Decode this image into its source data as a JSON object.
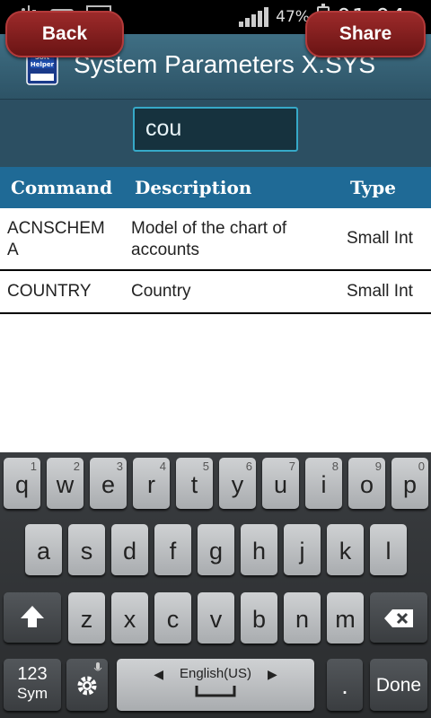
{
  "status_bar": {
    "battery_percent": "47%",
    "time": "01:04",
    "icons": [
      "usb-icon",
      "keyboard-icon",
      "image-icon",
      "signal-icon",
      "battery-charging-icon"
    ]
  },
  "app": {
    "title": "System Parameters X.SYS",
    "icon": "soft-helper-book-icon",
    "icon_text": "Soft Helper"
  },
  "toolbar": {
    "back_label": "Back",
    "share_label": "Share",
    "search_value": "cou"
  },
  "table": {
    "headers": {
      "command": "Command",
      "description": "Description",
      "type": "Type"
    },
    "rows": [
      {
        "command": "ACNSCHEM A",
        "description": "Model of the chart of accounts",
        "type": "Small Int"
      },
      {
        "command": "COUNTRY",
        "description": "Country",
        "type": "Small Int"
      }
    ]
  },
  "keyboard": {
    "row1": [
      {
        "k": "q",
        "n": "1"
      },
      {
        "k": "w",
        "n": "2"
      },
      {
        "k": "e",
        "n": "3"
      },
      {
        "k": "r",
        "n": "4"
      },
      {
        "k": "t",
        "n": "5"
      },
      {
        "k": "y",
        "n": "6"
      },
      {
        "k": "u",
        "n": "7"
      },
      {
        "k": "i",
        "n": "8"
      },
      {
        "k": "o",
        "n": "9"
      },
      {
        "k": "p",
        "n": "0"
      }
    ],
    "row2": [
      "a",
      "s",
      "d",
      "f",
      "g",
      "h",
      "j",
      "k",
      "l"
    ],
    "row3": [
      "z",
      "x",
      "c",
      "v",
      "b",
      "n",
      "m"
    ],
    "sym_line1": "123",
    "sym_line2": "Sym",
    "language": "English(US)",
    "period": ".",
    "done": "Done"
  },
  "colors": {
    "title_bar": "#3a6679",
    "table_header": "#1f6a96",
    "button_red": "#8a1f1f",
    "search_border": "#36a9c8"
  }
}
